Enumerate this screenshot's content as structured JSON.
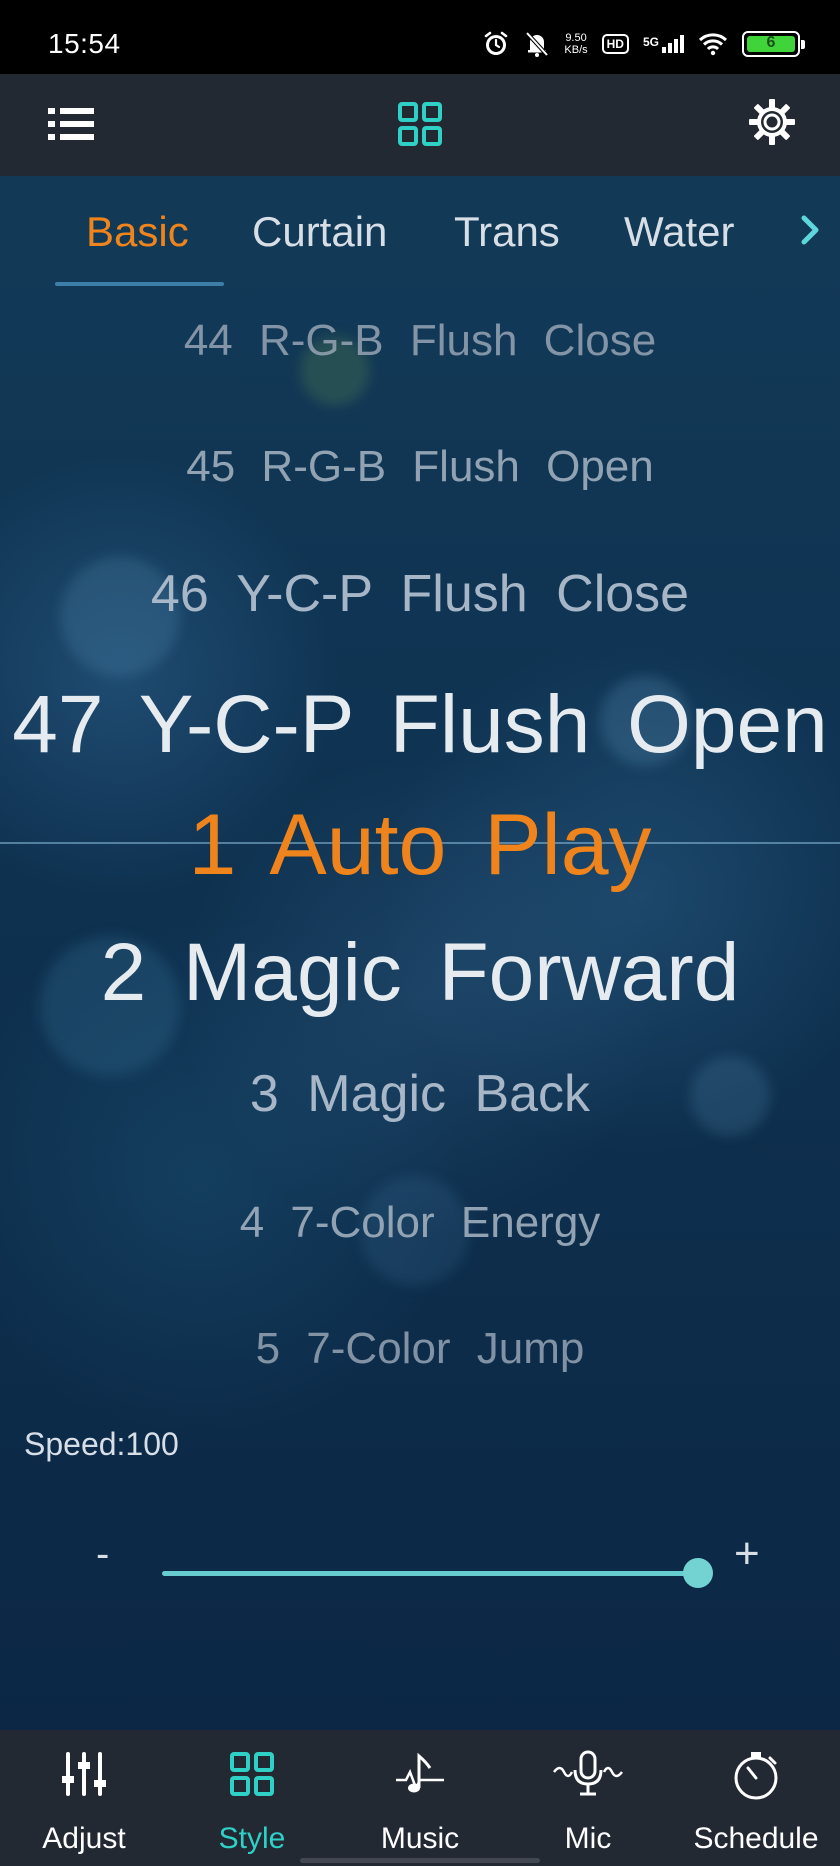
{
  "status_bar": {
    "time": "15:54",
    "net_speed_value": "9.50",
    "net_speed_unit": "KB/s",
    "hd_label": "HD",
    "network_label": "5G",
    "battery_level": "6"
  },
  "app_bar": {
    "menu_icon": "list-menu-icon",
    "center_icon": "grid-icon",
    "settings_icon": "gear-icon"
  },
  "tabs": {
    "items": [
      "Basic",
      "Curtain",
      "Trans",
      "Water"
    ],
    "active_index": 0,
    "more_icon": "chevron-right-icon"
  },
  "modes": {
    "items": [
      "44 R-G-B Flush Close",
      "45 R-G-B Flush Open",
      "46 Y-C-P Flush Close",
      "47 Y-C-P Flush Open",
      "1 Auto Play",
      "2 Magic Forward",
      "3 Magic Back",
      "4 7-Color Energy",
      "5 7-Color Jump"
    ],
    "selected": "1 Auto Play"
  },
  "speed": {
    "label": "Speed:100",
    "value": 100,
    "max": 100,
    "minus_label": "-",
    "plus_label": "+"
  },
  "bottom_nav": {
    "items": [
      {
        "label": "Adjust",
        "icon": "sliders-icon"
      },
      {
        "label": "Style",
        "icon": "grid-icon"
      },
      {
        "label": "Music",
        "icon": "music-note-icon"
      },
      {
        "label": "Mic",
        "icon": "microphone-icon"
      },
      {
        "label": "Schedule",
        "icon": "timer-icon"
      }
    ],
    "active_index": 1
  },
  "colors": {
    "accent_orange": "#f0841c",
    "accent_teal": "#2fd1c7",
    "slider": "#67cdd0",
    "bar_background": "#232932",
    "main_background": "#0f3352"
  }
}
